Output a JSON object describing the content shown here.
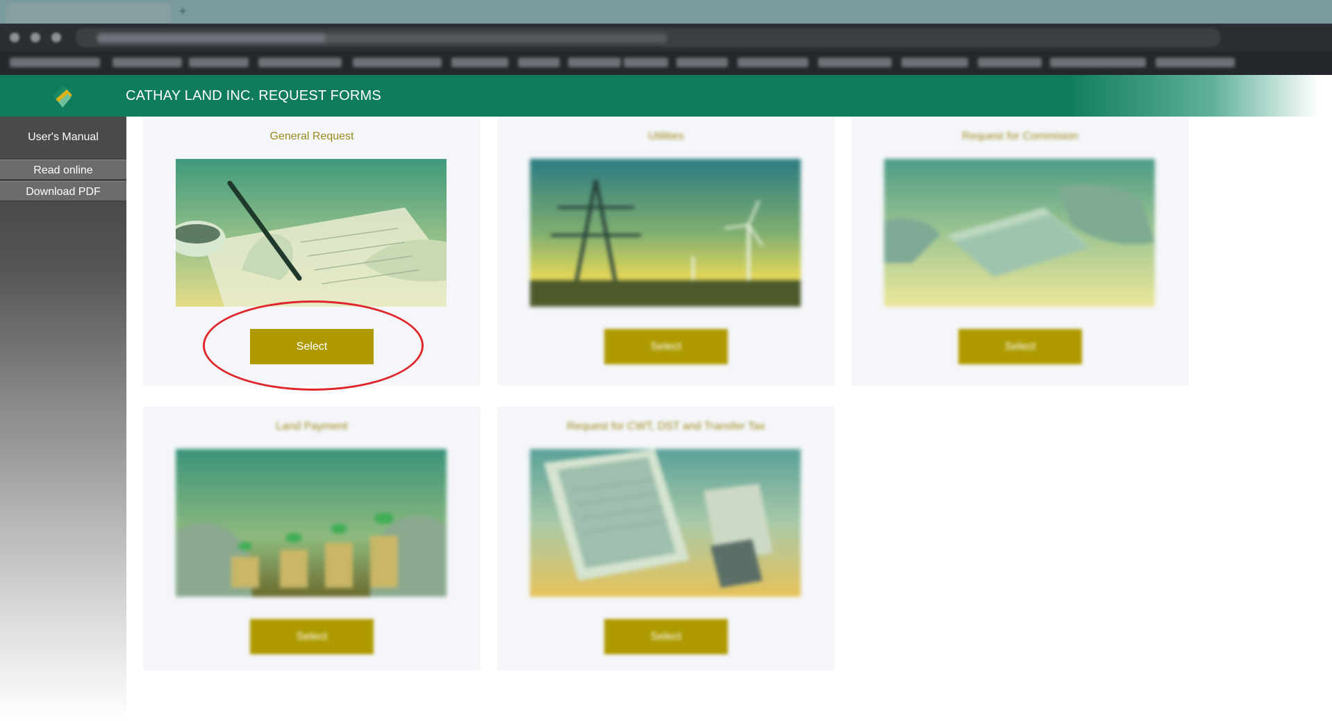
{
  "app": {
    "title": "CATHAY LAND INC. REQUEST FORMS",
    "colors": {
      "header": "#0e7b5d",
      "button": "#ae9a00",
      "card_title": "#9a8a1c",
      "highlight": "#e0262b"
    }
  },
  "sidebar": {
    "title": "User's Manual",
    "items": [
      {
        "label": "Read online"
      },
      {
        "label": "Download PDF"
      }
    ]
  },
  "cards": [
    {
      "title": "General Request",
      "image": "hand-writing-on-form-image",
      "button": "Select",
      "highlighted": true
    },
    {
      "title": "Utilities",
      "image": "power-lines-and-wind-turbines-image",
      "button": "Select",
      "highlighted": false
    },
    {
      "title": "Request for Commision",
      "image": "counting-money-image",
      "button": "Select",
      "highlighted": false
    },
    {
      "title": "Land Payment",
      "image": "plants-on-coin-stacks-image",
      "button": "Select",
      "highlighted": false
    },
    {
      "title": "Request for CWT, DST and Transfer Tax",
      "image": "documents-and-calculator-image",
      "button": "Select",
      "highlighted": false
    }
  ]
}
